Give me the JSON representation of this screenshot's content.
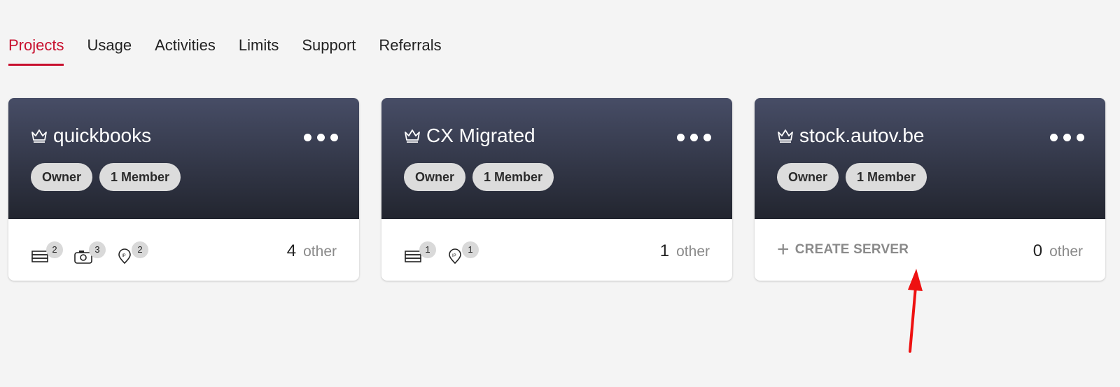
{
  "tabs": [
    {
      "label": "Projects",
      "active": true
    },
    {
      "label": "Usage"
    },
    {
      "label": "Activities"
    },
    {
      "label": "Limits"
    },
    {
      "label": "Support"
    },
    {
      "label": "Referrals"
    }
  ],
  "accent_color": "#c8102e",
  "cards": [
    {
      "title": "quickbooks",
      "role": "Owner",
      "members": "1 Member",
      "resources": [
        {
          "icon": "server-icon",
          "count": "2"
        },
        {
          "icon": "snapshot-icon",
          "count": "3"
        },
        {
          "icon": "ip-pin-icon",
          "count": "2"
        }
      ],
      "other_count": "4",
      "other_label": "other"
    },
    {
      "title": "CX Migrated",
      "role": "Owner",
      "members": "1 Member",
      "resources": [
        {
          "icon": "server-icon",
          "count": "1"
        },
        {
          "icon": "ip-pin-icon",
          "count": "1"
        }
      ],
      "other_count": "1",
      "other_label": "other"
    },
    {
      "title": "stock.autov.be",
      "role": "Owner",
      "members": "1 Member",
      "create_label": "CREATE SERVER",
      "other_count": "0",
      "other_label": "other"
    }
  ]
}
